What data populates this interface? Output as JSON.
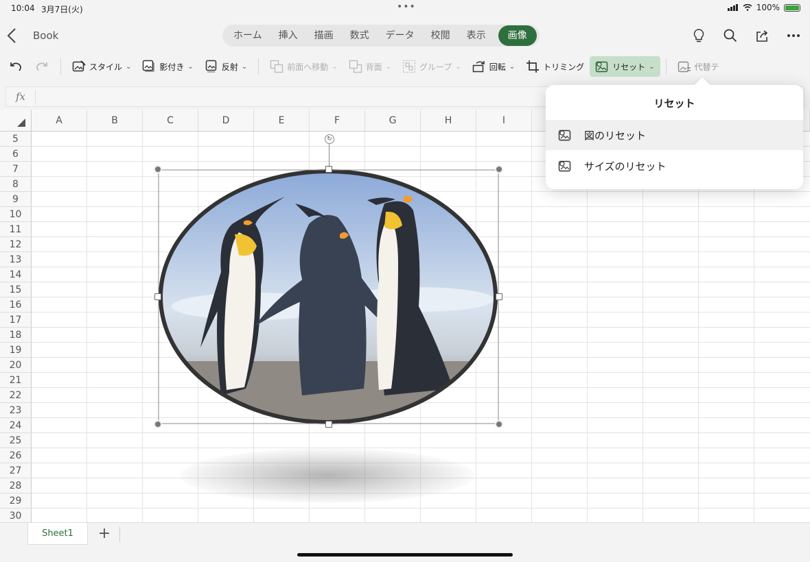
{
  "status": {
    "time": "10:04",
    "date": "3月7日(火)",
    "battery": "100%"
  },
  "header": {
    "title": "Book",
    "tabs": [
      "ホーム",
      "挿入",
      "描画",
      "数式",
      "データ",
      "校閲",
      "表示",
      "画像"
    ],
    "active_tab": "画像"
  },
  "ribbon": {
    "style": "スタイル",
    "shadow": "影付き",
    "reflection": "反射",
    "bring_forward": "前面へ移動",
    "send_back": "背面",
    "group": "グループ",
    "rotate": "回転",
    "crop": "トリミング",
    "reset": "リセット",
    "alt_text": "代替テ"
  },
  "formula": {
    "fx": "fx"
  },
  "grid": {
    "columns": [
      "A",
      "B",
      "C",
      "D",
      "E",
      "F",
      "G",
      "H",
      "I"
    ],
    "rows": [
      "5",
      "6",
      "7",
      "8",
      "9",
      "10",
      "11",
      "12",
      "13",
      "14",
      "15",
      "16",
      "17",
      "18",
      "19",
      "20",
      "21",
      "22",
      "23",
      "24",
      "25",
      "26",
      "27",
      "28",
      "29",
      "30"
    ]
  },
  "sheets": {
    "tabs": [
      "Sheet1"
    ],
    "add": "+"
  },
  "popover": {
    "title": "リセット",
    "items": [
      "図のリセット",
      "サイズのリセット"
    ]
  },
  "colors": {
    "accent": "#2f6f3e",
    "ribbon_selected": "#c7dfc9"
  }
}
